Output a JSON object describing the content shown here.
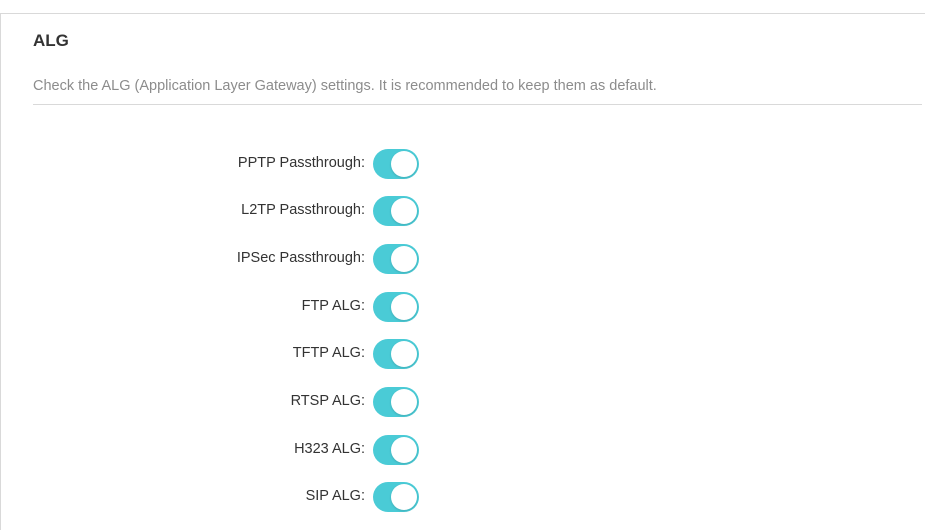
{
  "section": {
    "title": "ALG",
    "description": "Check the ALG (Application Layer Gateway) settings. It is recommended to keep them as default."
  },
  "settings": [
    {
      "label": "PPTP Passthrough:",
      "enabled": true
    },
    {
      "label": "L2TP Passthrough:",
      "enabled": true
    },
    {
      "label": "IPSec Passthrough:",
      "enabled": true
    },
    {
      "label": "FTP ALG:",
      "enabled": true
    },
    {
      "label": "TFTP ALG:",
      "enabled": true
    },
    {
      "label": "RTSP ALG:",
      "enabled": true
    },
    {
      "label": "H323 ALG:",
      "enabled": true
    },
    {
      "label": "SIP ALG:",
      "enabled": true
    }
  ],
  "colors": {
    "toggle_on": "#4acbd6",
    "label_text": "#333333",
    "description_text": "#8c8c8c"
  }
}
